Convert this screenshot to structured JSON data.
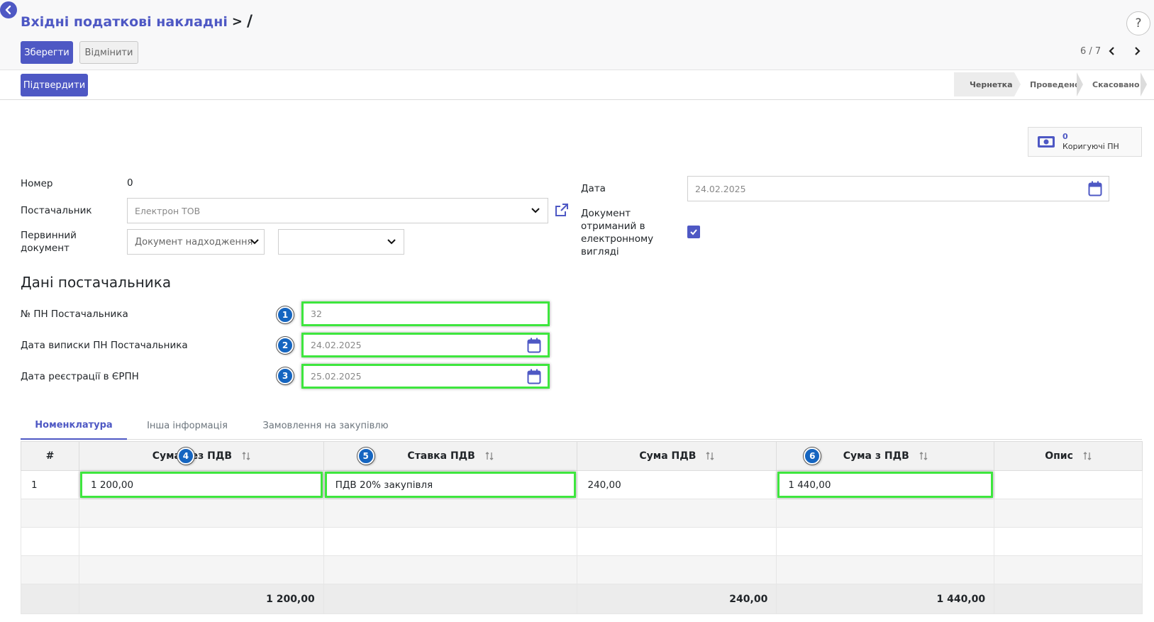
{
  "header": {
    "breadcrumb_parent": "Вхідні податкові накладні",
    "breadcrumb_separator": ">",
    "breadcrumb_current": "/",
    "help_label": "?"
  },
  "toolbar": {
    "save_label": "Зберегти",
    "discard_label": "Відмінити",
    "pager": "6 / 7",
    "confirm_label": "Підтвердити"
  },
  "status": {
    "stages": [
      "Чернетка",
      "Проведено",
      "Скасовано"
    ],
    "active_stage": "Чернетка"
  },
  "smart_button": {
    "count": "0",
    "label": "Коригуючі ПН"
  },
  "form": {
    "number_label": "Номер",
    "number_value": "0",
    "supplier_label": "Постачальник",
    "supplier_value": "Електрон ТОВ",
    "primary_doc_label": "Первинний документ",
    "primary_doc_type": "Документ надходження",
    "primary_doc_value": "",
    "date_label": "Дата",
    "date_value": "24.02.2025",
    "electronic_label": "Документ отриманий в електронному вигляді",
    "electronic_checked": true
  },
  "supplier_section": {
    "title": "Дані постачальника",
    "tax_invoice_no_label": "№ ПН Постачальника",
    "tax_invoice_no_value": "32",
    "issue_date_label": "Дата виписки ПН Постачальника",
    "issue_date_value": "24.02.2025",
    "registration_date_label": "Дата реєстрації в ЄРПН",
    "registration_date_value": "25.02.2025"
  },
  "badges": [
    "1",
    "2",
    "3",
    "4",
    "5",
    "6"
  ],
  "tabs": [
    {
      "label": "Номенклатура",
      "active": true
    },
    {
      "label": "Інша інформація",
      "active": false
    },
    {
      "label": "Замовлення на закупівлю",
      "active": false
    }
  ],
  "table": {
    "columns": [
      "#",
      "Сума без ПДВ",
      "Ставка ПДВ",
      "Сума ПДВ",
      "Сума з ПДВ",
      "Опис"
    ],
    "rows": [
      {
        "num": "1",
        "amount_no_vat": "1 200,00",
        "vat_rate": "ПДВ 20% закупівля",
        "vat_amount": "240,00",
        "amount_with_vat": "1 440,00",
        "description": ""
      }
    ],
    "totals": {
      "amount_no_vat": "1 200,00",
      "vat_amount": "240,00",
      "amount_with_vat": "1 440,00"
    }
  },
  "colors": {
    "accent": "#4e58c4",
    "highlight": "#3ee63e",
    "badge": "#1565c0"
  }
}
